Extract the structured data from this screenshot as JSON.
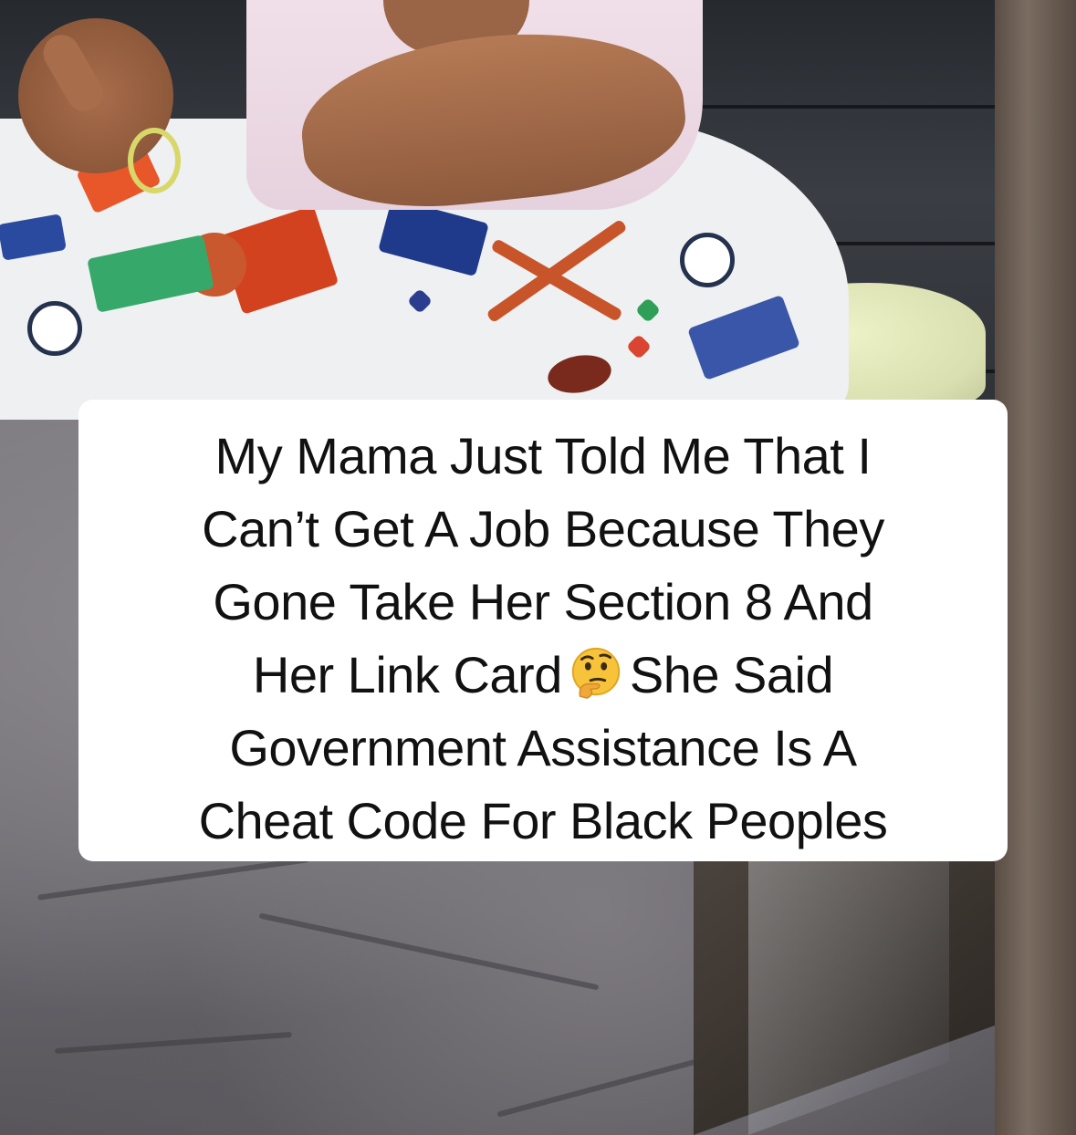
{
  "caption": {
    "lines": [
      "My Mama Just Told Me That I",
      "Can’t Get A Job Because They",
      "Gone Take Her Section 8 And",
      "Her Link Card",
      "She Said",
      "Government Assistance Is A",
      "Cheat Code For Black Peoples"
    ],
    "emoji": "thinking-face"
  },
  "colors": {
    "caption_bg": "#ffffff",
    "caption_text": "#111111"
  }
}
